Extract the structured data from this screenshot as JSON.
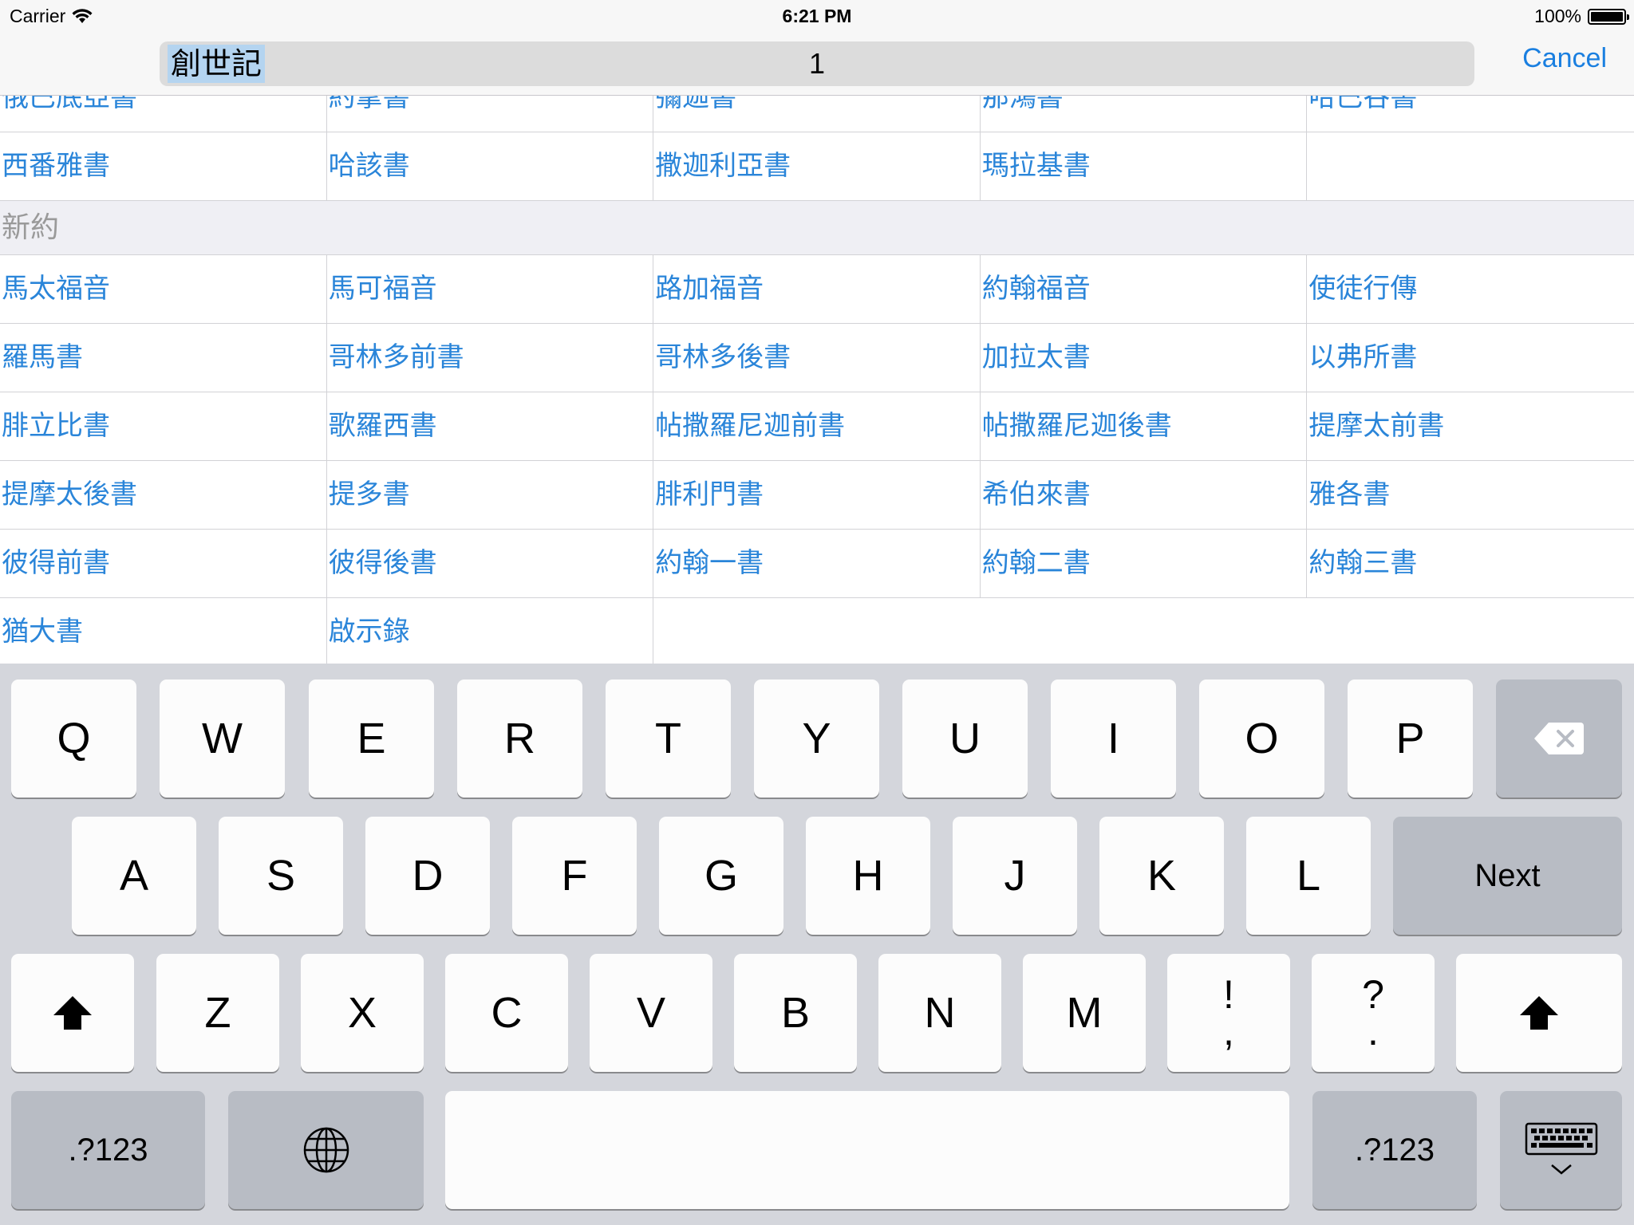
{
  "status_bar": {
    "carrier": "Carrier",
    "time": "6:21 PM",
    "battery": "100%"
  },
  "nav": {
    "search_book": "創世記",
    "search_chapter": "1",
    "cancel_label": "Cancel"
  },
  "books": {
    "old_testament_partial_rows": [
      [
        "俄巴底亞書",
        "約拿書",
        "彌迦書",
        "那鴻書",
        "哈巴谷書"
      ],
      [
        "西番雅書",
        "哈該書",
        "撒迦利亞書",
        "瑪拉基書",
        ""
      ]
    ],
    "new_testament_header": "新約",
    "new_testament_rows": [
      [
        "馬太福音",
        "馬可福音",
        "路加福音",
        "約翰福音",
        "使徒行傳"
      ],
      [
        "羅馬書",
        "哥林多前書",
        "哥林多後書",
        "加拉太書",
        "以弗所書"
      ],
      [
        "腓立比書",
        "歌羅西書",
        "帖撒羅尼迦前書",
        "帖撒羅尼迦後書",
        "提摩太前書"
      ],
      [
        "提摩太後書",
        "提多書",
        "腓利門書",
        "希伯來書",
        "雅各書"
      ],
      [
        "彼得前書",
        "彼得後書",
        "約翰一書",
        "約翰二書",
        "約翰三書"
      ],
      [
        "猶大書",
        "啟示錄",
        "",
        "",
        ""
      ]
    ]
  },
  "keyboard": {
    "row1": [
      "Q",
      "W",
      "E",
      "R",
      "T",
      "Y",
      "U",
      "I",
      "O",
      "P"
    ],
    "row2": [
      "A",
      "S",
      "D",
      "F",
      "G",
      "H",
      "J",
      "K",
      "L"
    ],
    "row3": [
      "Z",
      "X",
      "C",
      "V",
      "B",
      "N",
      "M"
    ],
    "punct1_top": "!",
    "punct1_bottom": ",",
    "punct2_top": "?",
    "punct2_bottom": ".",
    "next_label": "Next",
    "numbers_label": ".?123",
    "icons": {
      "delete": "delete-icon",
      "shift": "shift-icon",
      "globe": "globe-icon",
      "dismiss": "keyboard-dismiss-icon"
    }
  },
  "colors": {
    "accent": "#1a7fe0",
    "book_link": "#2a85d9",
    "section_header_text": "#9a9a9a",
    "keyboard_bg": "#d4d6dc"
  }
}
